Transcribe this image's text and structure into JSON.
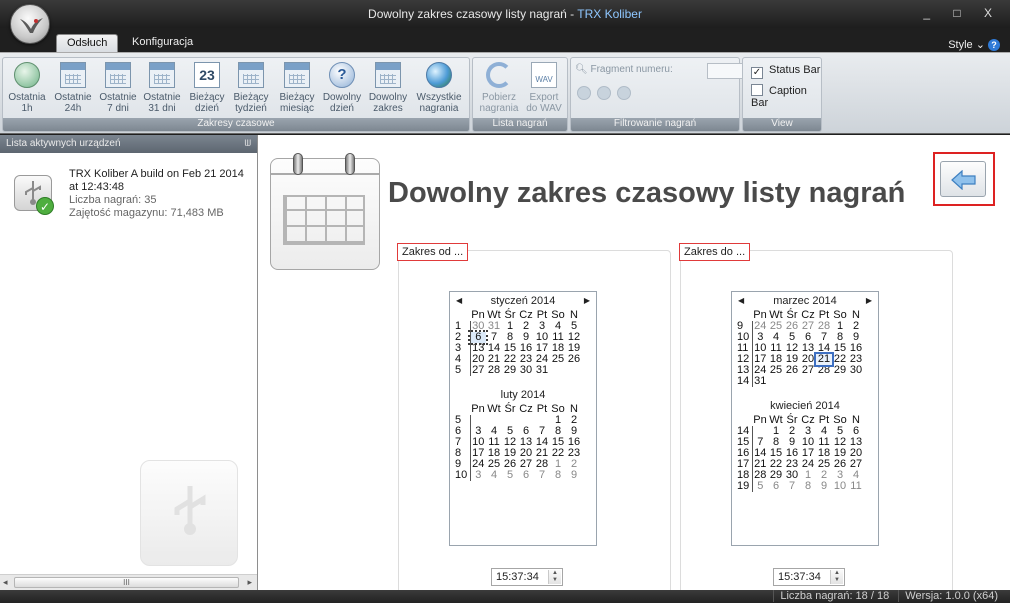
{
  "window": {
    "title_main": "Dowolny zakres czasowy listy nagrań",
    "title_sep": " - ",
    "title_app": "TRX Koliber",
    "controls": "_ □ X"
  },
  "tabs": [
    {
      "label": "Odsłuch"
    },
    {
      "label": "Konfiguracja"
    }
  ],
  "style_menu": {
    "label": "Style",
    "chevron": "⌄"
  },
  "ribbon": {
    "time_ranges": {
      "caption": "Zakresy czasowe",
      "buttons": [
        {
          "label1": "Ostatnia",
          "label2": "1h",
          "icon": "clock-icon"
        },
        {
          "label1": "Ostatnie",
          "label2": "24h",
          "icon": "calendar-24-icon"
        },
        {
          "label1": "Ostatnie",
          "label2": "7 dni",
          "icon": "calendar-7-icon"
        },
        {
          "label1": "Ostatnie",
          "label2": "31 dni",
          "icon": "calendar-31-icon"
        },
        {
          "label1": "Bieżący",
          "label2": "dzień",
          "icon": "calendar-day-icon",
          "badge": "23"
        },
        {
          "label1": "Bieżący",
          "label2": "tydzień",
          "icon": "calendar-week-icon"
        },
        {
          "label1": "Bieżący",
          "label2": "miesiąc",
          "icon": "calendar-month-icon"
        },
        {
          "label1": "Dowolny",
          "label2": "dzień",
          "icon": "calendar-question-icon",
          "badge": "?"
        },
        {
          "label1": "Dowolny",
          "label2": "zakres",
          "icon": "calendar-range-icon"
        },
        {
          "label1": "Wszystkie",
          "label2": "nagrania",
          "icon": "globe-icon"
        }
      ]
    },
    "recordings": {
      "caption": "Lista nagrań",
      "buttons": [
        {
          "label1": "Pobierz",
          "label2": "nagrania",
          "icon": "refresh-icon"
        },
        {
          "label1": "Export",
          "label2": "do WAV",
          "icon": "wav-icon",
          "badge": "WAV"
        }
      ]
    },
    "filter": {
      "caption": "Filtrowanie nagrań",
      "search_label": "Fragment numeru:"
    },
    "view": {
      "caption": "View",
      "status_bar": {
        "label": "Status Bar",
        "checked": true
      },
      "caption_bar": {
        "label": "Caption Bar",
        "checked": false
      }
    }
  },
  "left_panel": {
    "title": "Lista aktywnych urządzeń",
    "pin": "ᗯ",
    "device": {
      "name": "TRX Koliber A build on Feb 21 2014 at 12:43:48",
      "recordings": "Liczba nagrań: 35",
      "storage": "Zajętość magazynu: 71,483 MB"
    },
    "scroll": {
      "left": "◂",
      "right": "▸",
      "thumb": "III"
    }
  },
  "main": {
    "title": "Dowolny zakres czasowy listy nagrań",
    "from": {
      "label": "Zakres od ...",
      "time": "15:37:34",
      "months": [
        {
          "name": "styczeń 2014",
          "weekdays": [
            "Pn",
            "Wt",
            "Śr",
            "Cz",
            "Pt",
            "So",
            "N"
          ],
          "rows": [
            {
              "wk": "1",
              "days": [
                {
                  "d": "30",
                  "m": true
                },
                {
                  "d": "31",
                  "m": true
                },
                {
                  "d": "1"
                },
                {
                  "d": "2"
                },
                {
                  "d": "3"
                },
                {
                  "d": "4"
                },
                {
                  "d": "5"
                }
              ]
            },
            {
              "wk": "2",
              "days": [
                {
                  "d": "6",
                  "sel": true
                },
                {
                  "d": "7"
                },
                {
                  "d": "8"
                },
                {
                  "d": "9"
                },
                {
                  "d": "10"
                },
                {
                  "d": "11"
                },
                {
                  "d": "12"
                }
              ]
            },
            {
              "wk": "3",
              "days": [
                {
                  "d": "13"
                },
                {
                  "d": "14"
                },
                {
                  "d": "15"
                },
                {
                  "d": "16"
                },
                {
                  "d": "17"
                },
                {
                  "d": "18"
                },
                {
                  "d": "19"
                }
              ]
            },
            {
              "wk": "4",
              "days": [
                {
                  "d": "20"
                },
                {
                  "d": "21"
                },
                {
                  "d": "22"
                },
                {
                  "d": "23"
                },
                {
                  "d": "24"
                },
                {
                  "d": "25"
                },
                {
                  "d": "26"
                }
              ]
            },
            {
              "wk": "5",
              "days": [
                {
                  "d": "27"
                },
                {
                  "d": "28"
                },
                {
                  "d": "29"
                },
                {
                  "d": "30"
                },
                {
                  "d": "31"
                },
                {
                  "d": ""
                },
                {
                  "d": ""
                }
              ]
            }
          ]
        },
        {
          "name": "luty 2014",
          "weekdays": [
            "Pn",
            "Wt",
            "Śr",
            "Cz",
            "Pt",
            "So",
            "N"
          ],
          "rows": [
            {
              "wk": "5",
              "days": [
                {
                  "d": ""
                },
                {
                  "d": ""
                },
                {
                  "d": ""
                },
                {
                  "d": ""
                },
                {
                  "d": ""
                },
                {
                  "d": "1"
                },
                {
                  "d": "2"
                }
              ]
            },
            {
              "wk": "6",
              "days": [
                {
                  "d": "3"
                },
                {
                  "d": "4"
                },
                {
                  "d": "5"
                },
                {
                  "d": "6"
                },
                {
                  "d": "7"
                },
                {
                  "d": "8"
                },
                {
                  "d": "9"
                }
              ]
            },
            {
              "wk": "7",
              "days": [
                {
                  "d": "10"
                },
                {
                  "d": "11"
                },
                {
                  "d": "12"
                },
                {
                  "d": "13"
                },
                {
                  "d": "14"
                },
                {
                  "d": "15"
                },
                {
                  "d": "16"
                }
              ]
            },
            {
              "wk": "8",
              "days": [
                {
                  "d": "17"
                },
                {
                  "d": "18"
                },
                {
                  "d": "19"
                },
                {
                  "d": "20"
                },
                {
                  "d": "21"
                },
                {
                  "d": "22"
                },
                {
                  "d": "23"
                }
              ]
            },
            {
              "wk": "9",
              "days": [
                {
                  "d": "24"
                },
                {
                  "d": "25"
                },
                {
                  "d": "26"
                },
                {
                  "d": "27"
                },
                {
                  "d": "28"
                },
                {
                  "d": "1",
                  "m": true
                },
                {
                  "d": "2",
                  "m": true
                }
              ]
            },
            {
              "wk": "10",
              "days": [
                {
                  "d": "3",
                  "m": true
                },
                {
                  "d": "4",
                  "m": true
                },
                {
                  "d": "5",
                  "m": true
                },
                {
                  "d": "6",
                  "m": true
                },
                {
                  "d": "7",
                  "m": true
                },
                {
                  "d": "8",
                  "m": true
                },
                {
                  "d": "9",
                  "m": true
                }
              ]
            }
          ]
        }
      ]
    },
    "to": {
      "label": "Zakres do ...",
      "time": "15:37:34",
      "months": [
        {
          "name": "marzec 2014",
          "weekdays": [
            "Pn",
            "Wt",
            "Śr",
            "Cz",
            "Pt",
            "So",
            "N"
          ],
          "rows": [
            {
              "wk": "9",
              "days": [
                {
                  "d": "24",
                  "m": true
                },
                {
                  "d": "25",
                  "m": true
                },
                {
                  "d": "26",
                  "m": true
                },
                {
                  "d": "27",
                  "m": true
                },
                {
                  "d": "28",
                  "m": true
                },
                {
                  "d": "1"
                },
                {
                  "d": "2"
                }
              ]
            },
            {
              "wk": "10",
              "days": [
                {
                  "d": "3"
                },
                {
                  "d": "4"
                },
                {
                  "d": "5"
                },
                {
                  "d": "6"
                },
                {
                  "d": "7"
                },
                {
                  "d": "8"
                },
                {
                  "d": "9"
                }
              ]
            },
            {
              "wk": "11",
              "days": [
                {
                  "d": "10"
                },
                {
                  "d": "11"
                },
                {
                  "d": "12"
                },
                {
                  "d": "13"
                },
                {
                  "d": "14"
                },
                {
                  "d": "15"
                },
                {
                  "d": "16"
                }
              ]
            },
            {
              "wk": "12",
              "days": [
                {
                  "d": "17"
                },
                {
                  "d": "18"
                },
                {
                  "d": "19"
                },
                {
                  "d": "20"
                },
                {
                  "d": "21",
                  "today": true
                },
                {
                  "d": "22"
                },
                {
                  "d": "23"
                }
              ]
            },
            {
              "wk": "13",
              "days": [
                {
                  "d": "24"
                },
                {
                  "d": "25"
                },
                {
                  "d": "26"
                },
                {
                  "d": "27"
                },
                {
                  "d": "28"
                },
                {
                  "d": "29"
                },
                {
                  "d": "30"
                }
              ]
            },
            {
              "wk": "14",
              "days": [
                {
                  "d": "31"
                },
                {
                  "d": ""
                },
                {
                  "d": ""
                },
                {
                  "d": ""
                },
                {
                  "d": ""
                },
                {
                  "d": ""
                },
                {
                  "d": ""
                }
              ]
            }
          ]
        },
        {
          "name": "kwiecień 2014",
          "weekdays": [
            "Pn",
            "Wt",
            "Śr",
            "Cz",
            "Pt",
            "So",
            "N"
          ],
          "rows": [
            {
              "wk": "14",
              "days": [
                {
                  "d": ""
                },
                {
                  "d": "1"
                },
                {
                  "d": "2"
                },
                {
                  "d": "3"
                },
                {
                  "d": "4"
                },
                {
                  "d": "5"
                },
                {
                  "d": "6"
                }
              ]
            },
            {
              "wk": "15",
              "days": [
                {
                  "d": "7"
                },
                {
                  "d": "8"
                },
                {
                  "d": "9"
                },
                {
                  "d": "10"
                },
                {
                  "d": "11"
                },
                {
                  "d": "12"
                },
                {
                  "d": "13"
                }
              ]
            },
            {
              "wk": "16",
              "days": [
                {
                  "d": "14"
                },
                {
                  "d": "15"
                },
                {
                  "d": "16"
                },
                {
                  "d": "17"
                },
                {
                  "d": "18"
                },
                {
                  "d": "19"
                },
                {
                  "d": "20"
                }
              ]
            },
            {
              "wk": "17",
              "days": [
                {
                  "d": "21"
                },
                {
                  "d": "22"
                },
                {
                  "d": "23"
                },
                {
                  "d": "24"
                },
                {
                  "d": "25"
                },
                {
                  "d": "26"
                },
                {
                  "d": "27"
                }
              ]
            },
            {
              "wk": "18",
              "days": [
                {
                  "d": "28"
                },
                {
                  "d": "29"
                },
                {
                  "d": "30"
                },
                {
                  "d": "1",
                  "m": true
                },
                {
                  "d": "2",
                  "m": true
                },
                {
                  "d": "3",
                  "m": true
                },
                {
                  "d": "4",
                  "m": true
                }
              ]
            },
            {
              "wk": "19",
              "days": [
                {
                  "d": "5",
                  "m": true
                },
                {
                  "d": "6",
                  "m": true
                },
                {
                  "d": "7",
                  "m": true
                },
                {
                  "d": "8",
                  "m": true
                },
                {
                  "d": "9",
                  "m": true
                },
                {
                  "d": "10",
                  "m": true
                },
                {
                  "d": "11",
                  "m": true
                }
              ]
            }
          ]
        }
      ]
    }
  },
  "status_bar": {
    "count": "Liczba nagrań: 18 / 18",
    "version": "Wersja: 1.0.0 (x64)"
  },
  "colors": {
    "highlight_border": "#d22222",
    "accent_title": "#8fc7ff"
  }
}
